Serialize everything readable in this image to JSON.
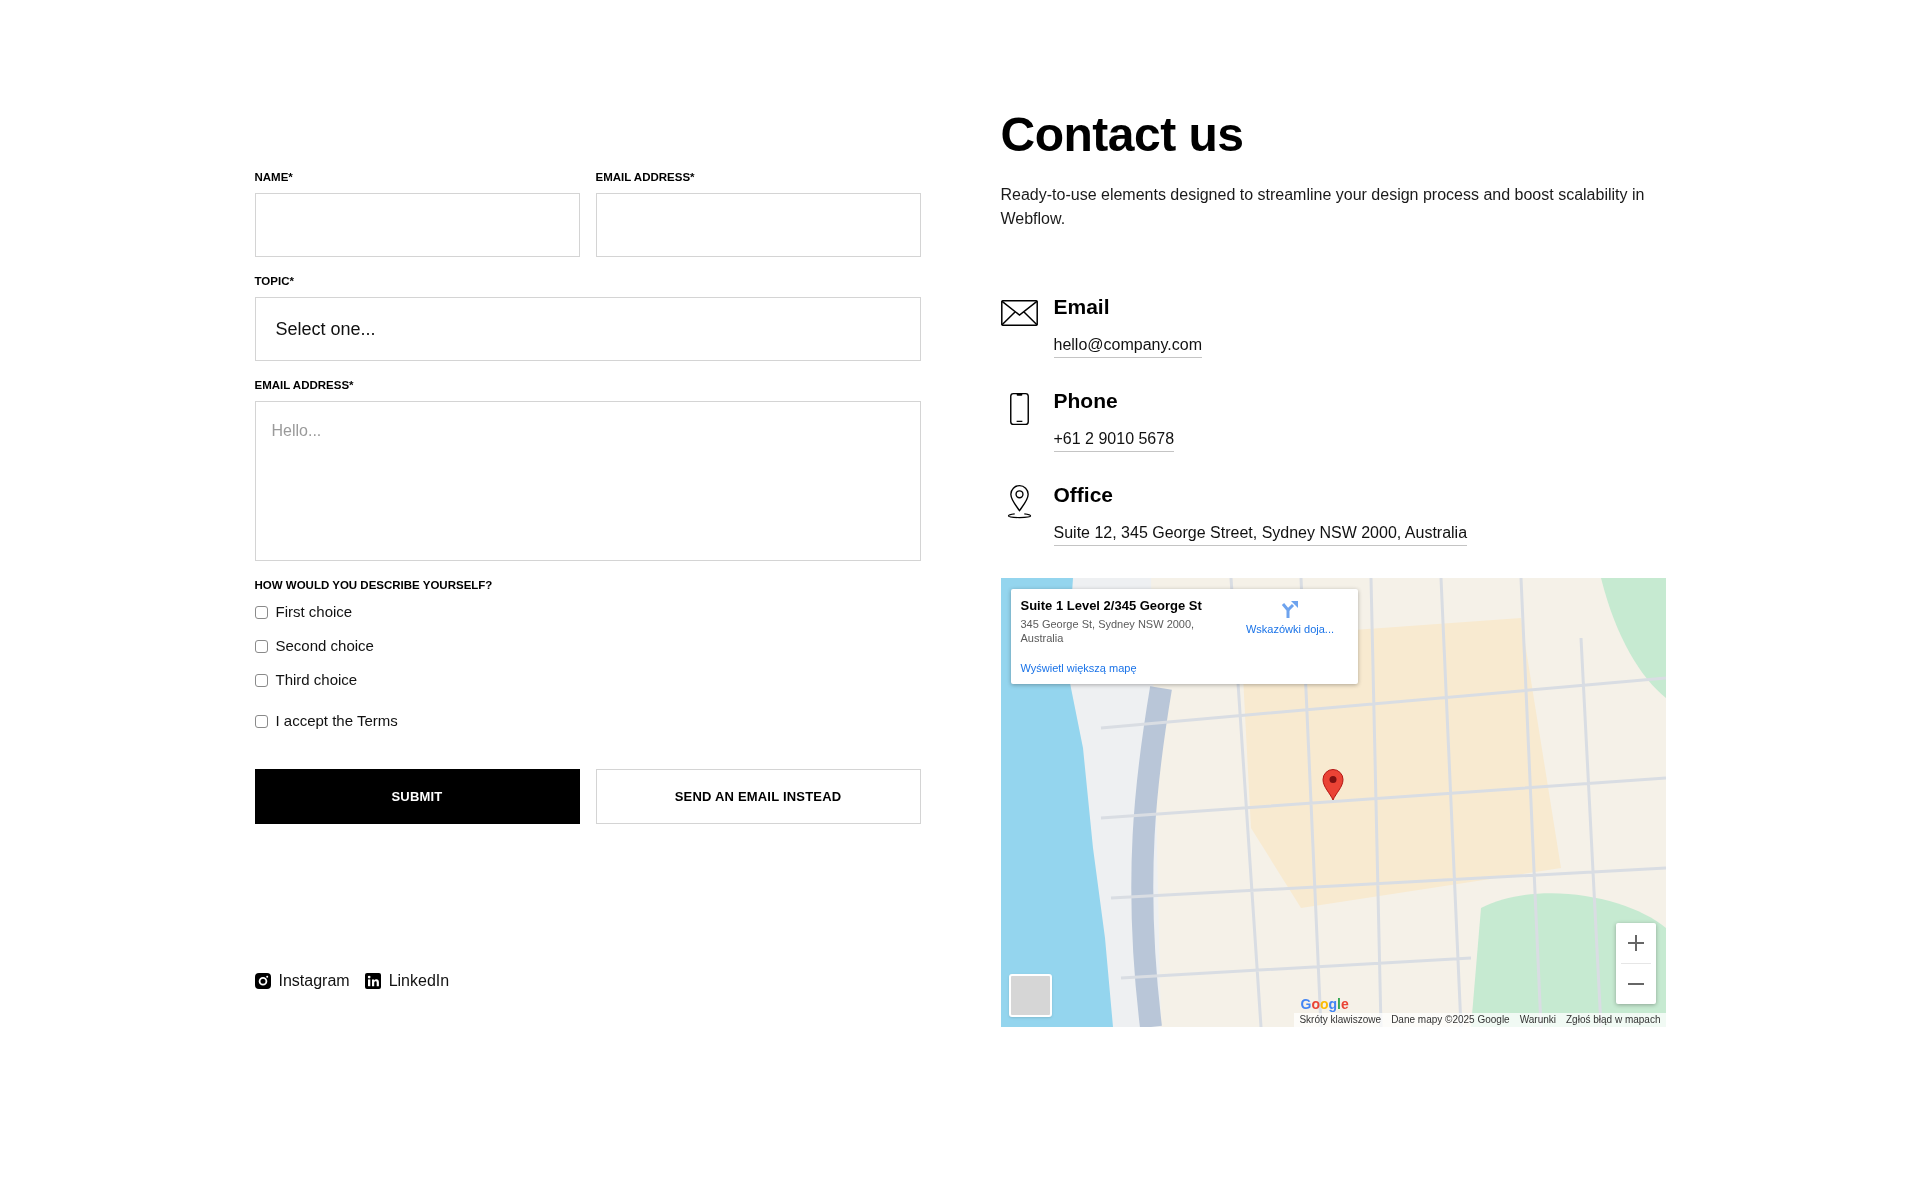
{
  "form": {
    "rows": [
      [
        {
          "kind": "input",
          "label": "NAME*"
        },
        {
          "kind": "input",
          "label": "EMAIL ADDRESS*"
        }
      ],
      [
        {
          "kind": "select",
          "label": "TOPIC*",
          "value": "Select one..."
        }
      ],
      [
        {
          "kind": "textarea",
          "label": "EMAIL ADDRESS*",
          "placeholder": "Hello..."
        }
      ]
    ],
    "question": "HOW WOULD YOU DESCRIBE YOURSELF?",
    "choices": [
      {
        "label": "First choice",
        "checked": false
      },
      {
        "label": "Second choice",
        "checked": false
      },
      {
        "label": "Third choice",
        "checked": false
      }
    ],
    "terms": {
      "label": "I accept the Terms",
      "checked": false
    },
    "buttons": [
      {
        "label": "SUBMIT",
        "kind": "primary"
      },
      {
        "label": "SEND AN EMAIL INSTEAD",
        "kind": "secondary"
      }
    ]
  },
  "social_links": [
    {
      "kind": "instagram",
      "label": "Instagram"
    },
    {
      "kind": "linkedin",
      "label": "LinkedIn"
    }
  ],
  "contact": {
    "title": "Contact us",
    "description": "Ready-to-use elements designed to streamline your design process and boost scalability in Webflow.",
    "items": [
      {
        "kind": "email",
        "title": "Email",
        "value": "hello@company.com"
      },
      {
        "kind": "phone",
        "title": "Phone",
        "value": "+61 2 9010 5678"
      },
      {
        "kind": "office",
        "title": "Office",
        "value": "Suite 12, 345 George Street, Sydney NSW 2000, Australia"
      }
    ]
  },
  "map": {
    "info_card": {
      "title": "Suite 1 Level 2/345 George St",
      "address": "345 George St, Sydney NSW 2000, Australia",
      "directions": "Wskazówki doja...",
      "larger_map_link": "Wyświetl większą mapę"
    },
    "logo": "Google",
    "attribution": [
      "Skróty klawiszowe",
      "Dane mapy ©2025 Google",
      "Warunki",
      "Zgłoś błąd w mapach"
    ]
  }
}
